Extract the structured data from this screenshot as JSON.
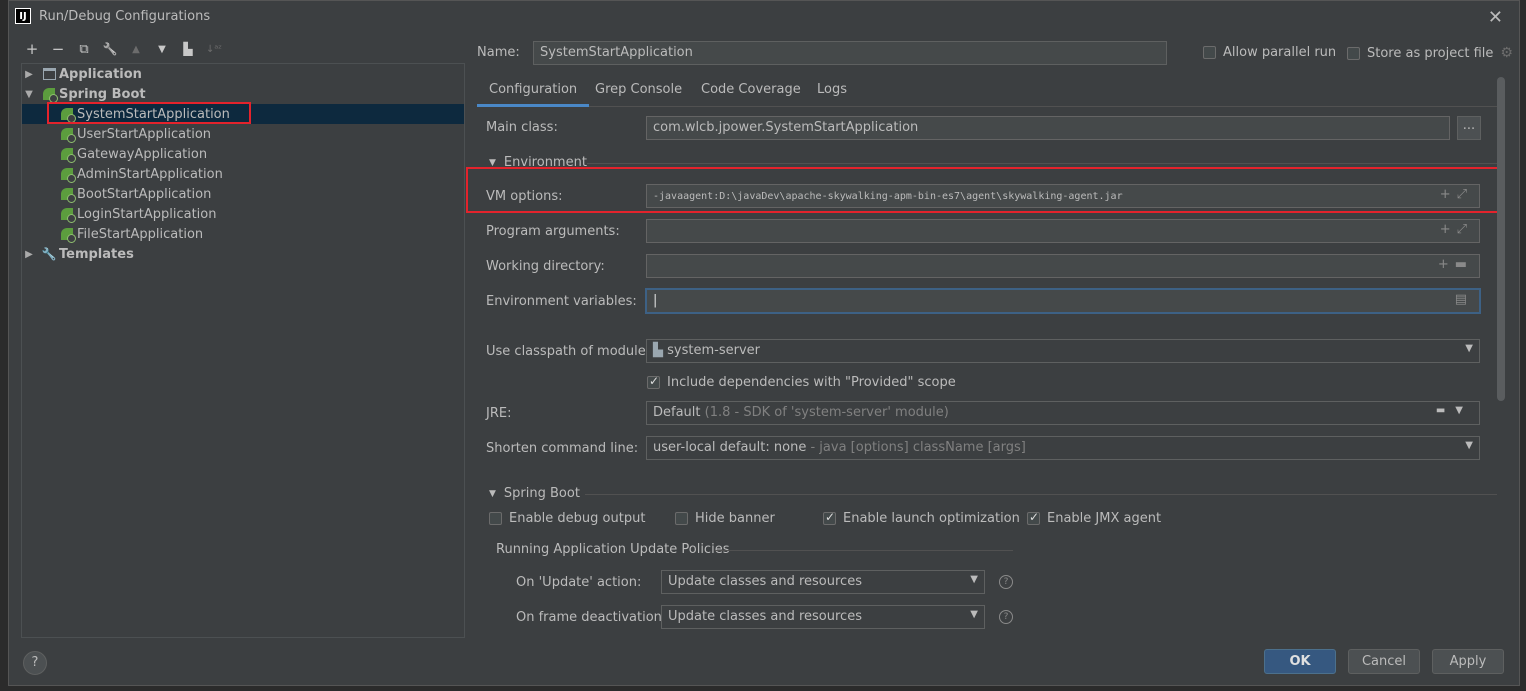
{
  "window": {
    "title": "Run/Debug Configurations",
    "logo": "IJ"
  },
  "toolbar": {
    "add": "+",
    "remove": "−",
    "copy": "⧉",
    "edit_defaults": "🔧",
    "move_up": "▲",
    "move_down": "▼",
    "folder": "▙",
    "sort": "↓ᵃᶻ"
  },
  "tree": {
    "application": "Application",
    "spring_boot": "Spring Boot",
    "items": [
      "SystemStartApplication",
      "UserStartApplication",
      "GatewayApplication",
      "AdminStartApplication",
      "BootStartApplication",
      "LoginStartApplication",
      "FileStartApplication"
    ],
    "templates": "Templates"
  },
  "header": {
    "name_label": "Name:",
    "name_value": "SystemStartApplication",
    "allow_parallel": "Allow parallel run",
    "store_project": "Store as project file"
  },
  "tabs": [
    "Configuration",
    "Grep Console",
    "Code Coverage",
    "Logs"
  ],
  "config": {
    "main_class_label": "Main class:",
    "main_class_value": "com.wlcb.jpower.SystemStartApplication",
    "browse": "...",
    "environment_section": "Environment",
    "vm_label": "VM options:",
    "vm_value": "-javaagent:D:\\javaDev\\apache-skywalking-apm-bin-es7\\agent\\skywalking-agent.jar",
    "program_args_label": "Program arguments:",
    "working_dir_label": "Working directory:",
    "env_vars_label": "Environment variables:",
    "classpath_label": "Use classpath of module:",
    "classpath_value": "system-server",
    "include_deps": "Include dependencies with \"Provided\" scope",
    "jre_label": "JRE:",
    "jre_value": "Default",
    "jre_hint": "(1.8 - SDK of 'system-server' module)",
    "shorten_label": "Shorten command line:",
    "shorten_value": "user-local default: none",
    "shorten_hint": "- java [options] className [args]",
    "spring_boot_section": "Spring Boot",
    "enable_debug": "Enable debug output",
    "hide_banner": "Hide banner",
    "enable_launch_opt": "Enable launch optimization",
    "enable_jmx": "Enable JMX agent",
    "policies_title": "Running Application Update Policies",
    "on_update_label": "On 'Update' action:",
    "on_update_value": "Update classes and resources",
    "on_frame_label": "On frame deactivation:",
    "on_frame_value": "Update classes and resources"
  },
  "buttons": {
    "help": "?",
    "ok": "OK",
    "cancel": "Cancel",
    "apply": "Apply"
  },
  "colors": {
    "selection": "#0d293e",
    "highlight": "#e3232c",
    "accent": "#4a88c7",
    "primary_button": "#365880"
  }
}
